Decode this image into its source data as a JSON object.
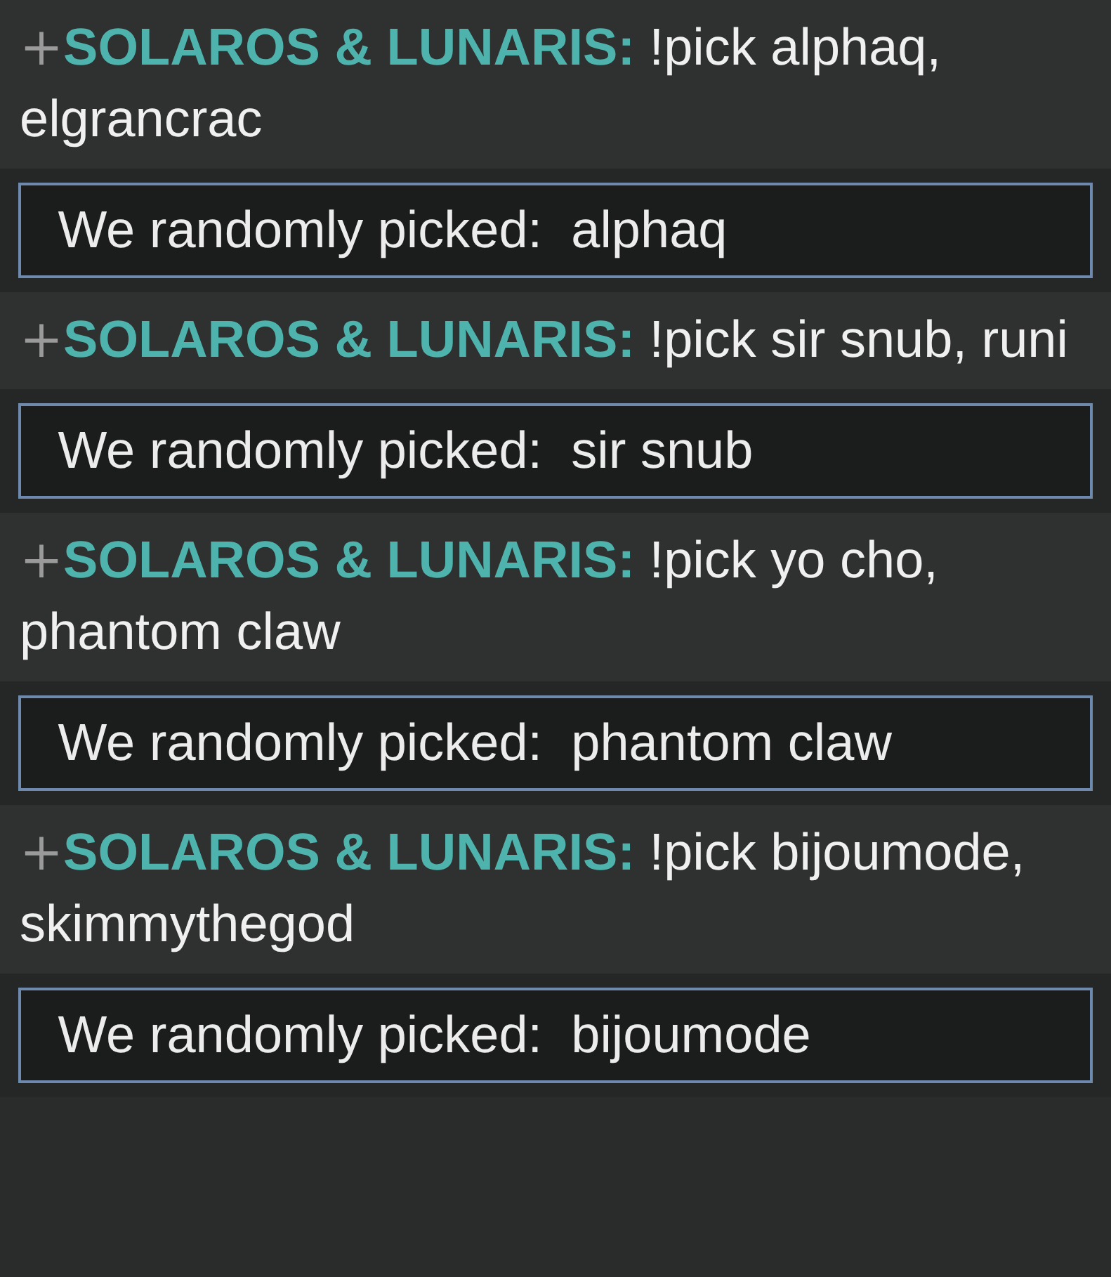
{
  "messages": [
    {
      "kind": "user",
      "prefix": "+",
      "username": "SOLAROS & LUNARIS:",
      "text": "!pick alphaq, elgrancrac"
    },
    {
      "kind": "bot",
      "label": "We randomly picked:",
      "value": "alphaq"
    },
    {
      "kind": "user",
      "prefix": "+",
      "username": "SOLAROS & LUNARIS:",
      "text": "!pick sir snub, runi"
    },
    {
      "kind": "bot",
      "label": "We randomly picked:",
      "value": "sir snub"
    },
    {
      "kind": "user",
      "prefix": "+",
      "username": "SOLAROS & LUNARIS:",
      "text": "!pick yo cho, phantom claw"
    },
    {
      "kind": "bot",
      "label": "We randomly picked:",
      "value": "phantom claw"
    },
    {
      "kind": "user",
      "prefix": "+",
      "username": "SOLAROS & LUNARIS:",
      "text": "!pick bijoumode, skimmythegod"
    },
    {
      "kind": "bot",
      "label": "We randomly picked:",
      "value": "bijoumode"
    }
  ]
}
